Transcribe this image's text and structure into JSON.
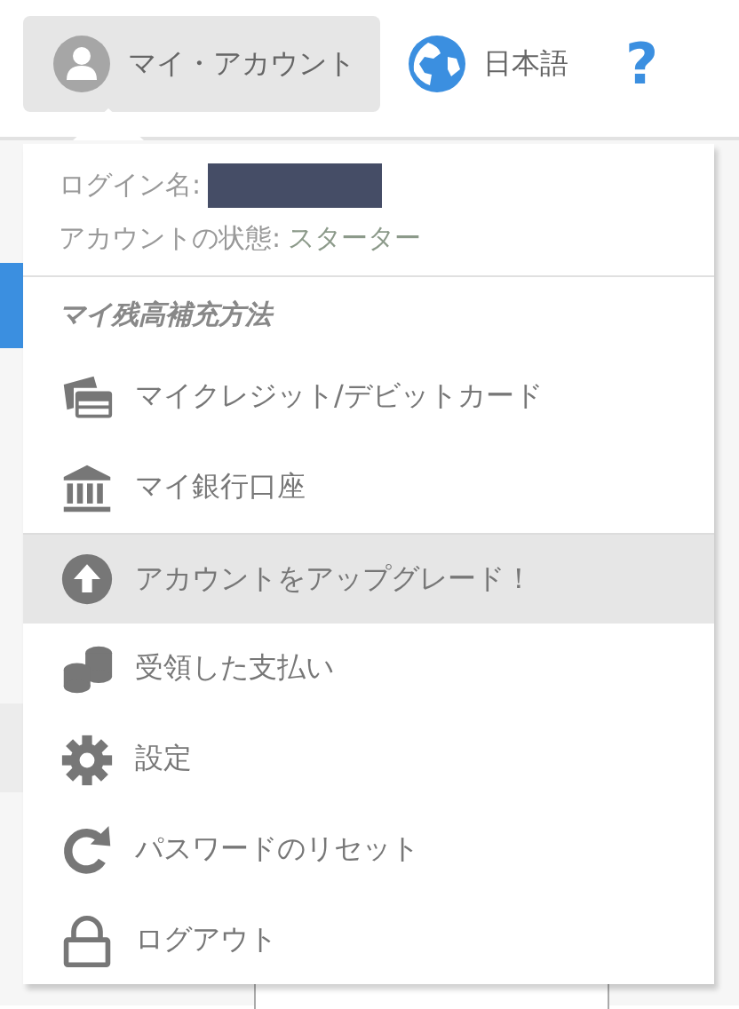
{
  "header": {
    "account_button": {
      "label": "マイ・アカウント",
      "selected": true
    },
    "language": {
      "label": "日本語"
    },
    "help": {
      "label": "?"
    }
  },
  "account_menu": {
    "login_name": {
      "label": "ログイン名:",
      "redacted": true
    },
    "status": {
      "label": "アカウントの状態:",
      "value": "スターター"
    },
    "section_heading": "マイ残高補充方法",
    "items": [
      {
        "kind": "card",
        "label": "マイクレジット/デビットカード",
        "selected": false
      },
      {
        "kind": "bank",
        "label": "マイ銀行口座",
        "selected": false
      },
      {
        "kind": "upgrade",
        "label": "アカウントをアップグレード！",
        "selected": true
      },
      {
        "kind": "coins",
        "label": "受領した支払い",
        "selected": false
      },
      {
        "kind": "settings",
        "label": "設定",
        "selected": false
      },
      {
        "kind": "reset",
        "label": "パスワードのリセット",
        "selected": false
      },
      {
        "kind": "lock",
        "label": "ログアウト",
        "selected": false
      }
    ]
  }
}
